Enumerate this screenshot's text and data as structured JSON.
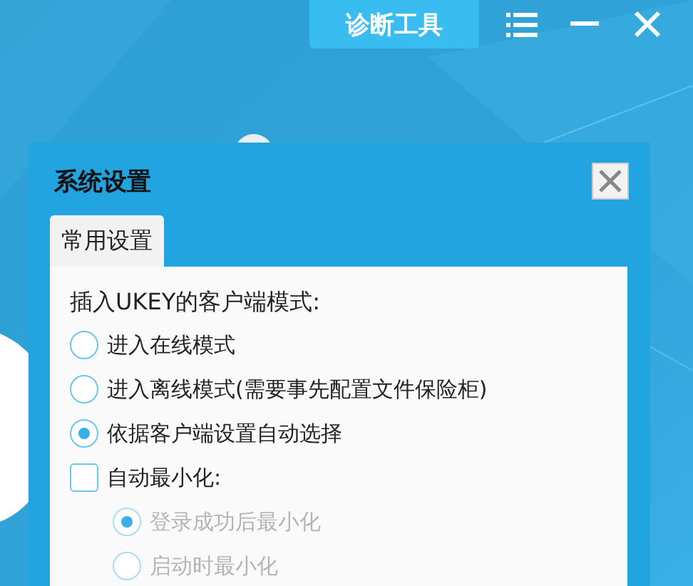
{
  "toolbar": {
    "diagnose_button": "诊断工具"
  },
  "dialog": {
    "title": "系统设置",
    "tabs": [
      {
        "label": "常用设置",
        "selected": true
      }
    ],
    "section_label": "插入UKEY的客户端模式:",
    "options": [
      {
        "kind": "radio",
        "label": "进入在线模式",
        "selected": false,
        "disabled": false
      },
      {
        "kind": "radio",
        "label": "进入离线模式(需要事先配置文件保险柜)",
        "selected": false,
        "disabled": false
      },
      {
        "kind": "radio",
        "label": "依据客户端设置自动选择",
        "selected": true,
        "disabled": false
      },
      {
        "kind": "checkbox",
        "label": "自动最小化:",
        "checked": false,
        "disabled": false,
        "children": [
          {
            "kind": "radio",
            "label": "登录成功后最小化",
            "selected": true,
            "disabled": true
          },
          {
            "kind": "radio",
            "label": "启动时最小化",
            "selected": false,
            "disabled": true
          }
        ]
      }
    ]
  }
}
